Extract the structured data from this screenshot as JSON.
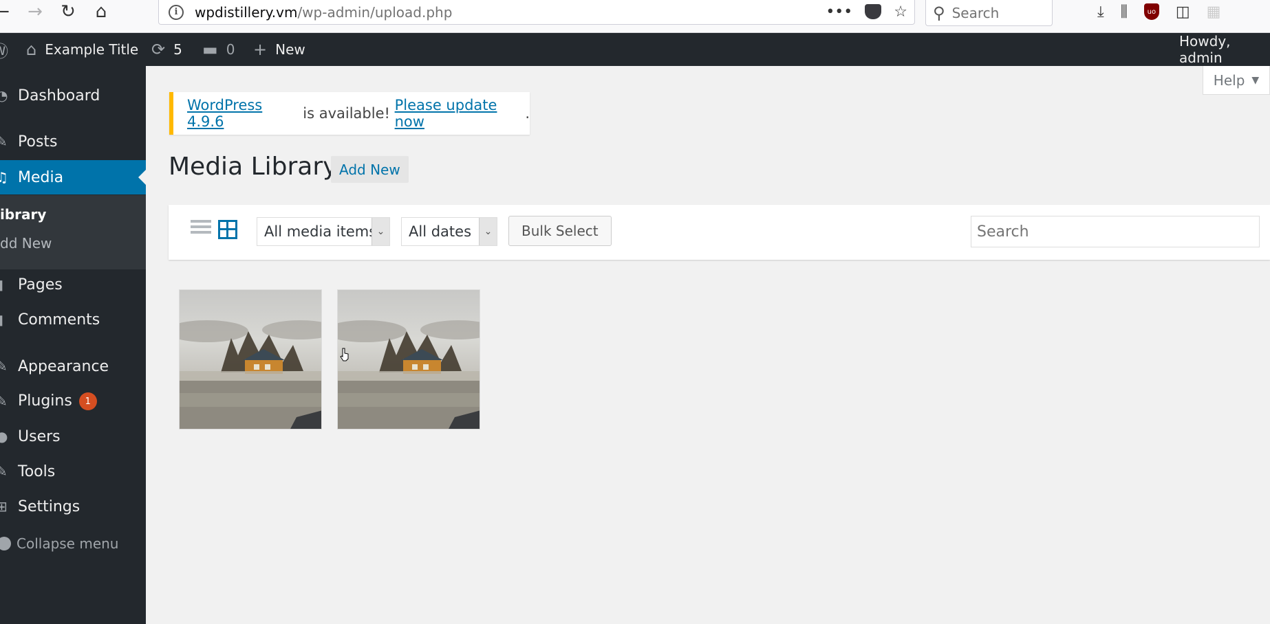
{
  "browser": {
    "url_domain": "wpdistillery.vm",
    "url_path": "/wp-admin/upload.php",
    "search_placeholder": "Search",
    "more_icon": "•••"
  },
  "adminbar": {
    "site_title": "Example Title",
    "updates_count": "5",
    "comments_count": "0",
    "new_label": "New",
    "howdy": "Howdy, admin"
  },
  "sidebar": {
    "dashboard": "Dashboard",
    "posts": "Posts",
    "media": "Media",
    "sub_library": "ibrary",
    "sub_add_new": "dd New",
    "pages": "Pages",
    "comments": "Comments",
    "appearance": "Appearance",
    "plugins": "Plugins",
    "plugins_badge": "1",
    "users": "Users",
    "tools": "Tools",
    "settings": "Settings",
    "collapse": "Collapse menu"
  },
  "help": {
    "label": "Help"
  },
  "notice": {
    "version_link": "WordPress 4.9.6",
    "middle_text": " is available! ",
    "update_link": "Please update now",
    "end_text": "."
  },
  "main": {
    "title": "Media Library",
    "add_new": "Add New",
    "filter_type": "All media items",
    "filter_date": "All dates",
    "bulk_select": "Bulk Select",
    "search_placeholder": "Search"
  },
  "media_items": [
    {
      "kind": "image",
      "subject": "misty lakeside house"
    },
    {
      "kind": "image",
      "subject": "misty lakeside house"
    }
  ],
  "colors": {
    "admin_dark": "#23282d",
    "accent_blue": "#0073aa",
    "notice_yellow": "#ffb900",
    "badge_orange": "#d54e21"
  }
}
